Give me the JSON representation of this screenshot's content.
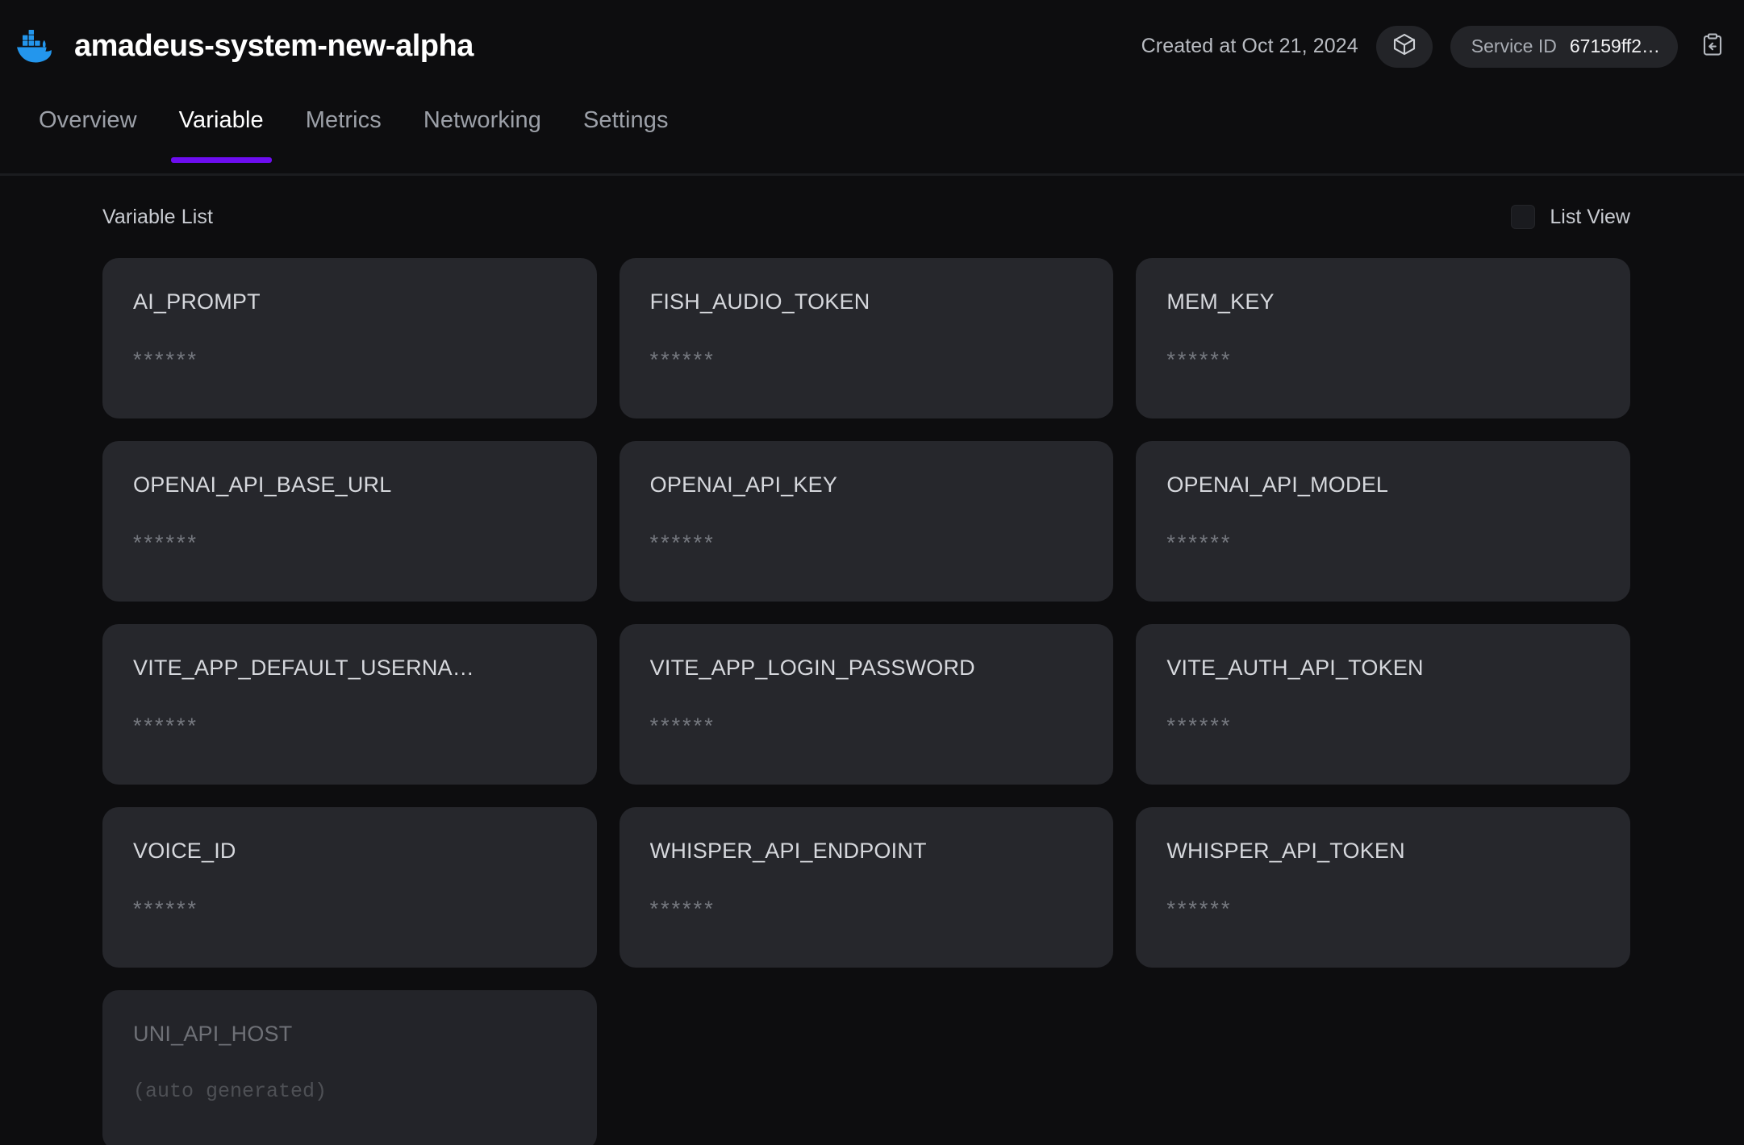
{
  "theme": {
    "accent": "#6d0df0",
    "background": "#0d0d0f",
    "card": "#26272c",
    "card_muted": "#232429"
  },
  "header": {
    "logo_icon": "docker-whale-icon",
    "title": "amadeus-system-new-alpha",
    "created_at": "Created at Oct 21, 2024",
    "container_icon": "cube-icon",
    "service_id_label": "Service ID",
    "service_id_value": "67159ff2…",
    "copy_icon": "clipboard-paste-icon"
  },
  "tabs": [
    {
      "label": "Overview",
      "active": false
    },
    {
      "label": "Variable",
      "active": true
    },
    {
      "label": "Metrics",
      "active": false
    },
    {
      "label": "Networking",
      "active": false
    },
    {
      "label": "Settings",
      "active": false
    }
  ],
  "main": {
    "list_title": "Variable List",
    "list_view_label": "List View",
    "list_view_checked": false,
    "variables": [
      {
        "name": "AI_PROMPT",
        "value": "******",
        "muted": false
      },
      {
        "name": "FISH_AUDIO_TOKEN",
        "value": "******",
        "muted": false
      },
      {
        "name": "MEM_KEY",
        "value": "******",
        "muted": false
      },
      {
        "name": "OPENAI_API_BASE_URL",
        "value": "******",
        "muted": false
      },
      {
        "name": "OPENAI_API_KEY",
        "value": "******",
        "muted": false
      },
      {
        "name": "OPENAI_API_MODEL",
        "value": "******",
        "muted": false
      },
      {
        "name": "VITE_APP_DEFAULT_USERNA…",
        "value": "******",
        "muted": false
      },
      {
        "name": "VITE_APP_LOGIN_PASSWORD",
        "value": "******",
        "muted": false
      },
      {
        "name": "VITE_AUTH_API_TOKEN",
        "value": "******",
        "muted": false
      },
      {
        "name": "VOICE_ID",
        "value": "******",
        "muted": false
      },
      {
        "name": "WHISPER_API_ENDPOINT",
        "value": "******",
        "muted": false
      },
      {
        "name": "WHISPER_API_TOKEN",
        "value": "******",
        "muted": false
      },
      {
        "name": "UNI_API_HOST",
        "value": "(auto generated)",
        "muted": true
      }
    ]
  }
}
